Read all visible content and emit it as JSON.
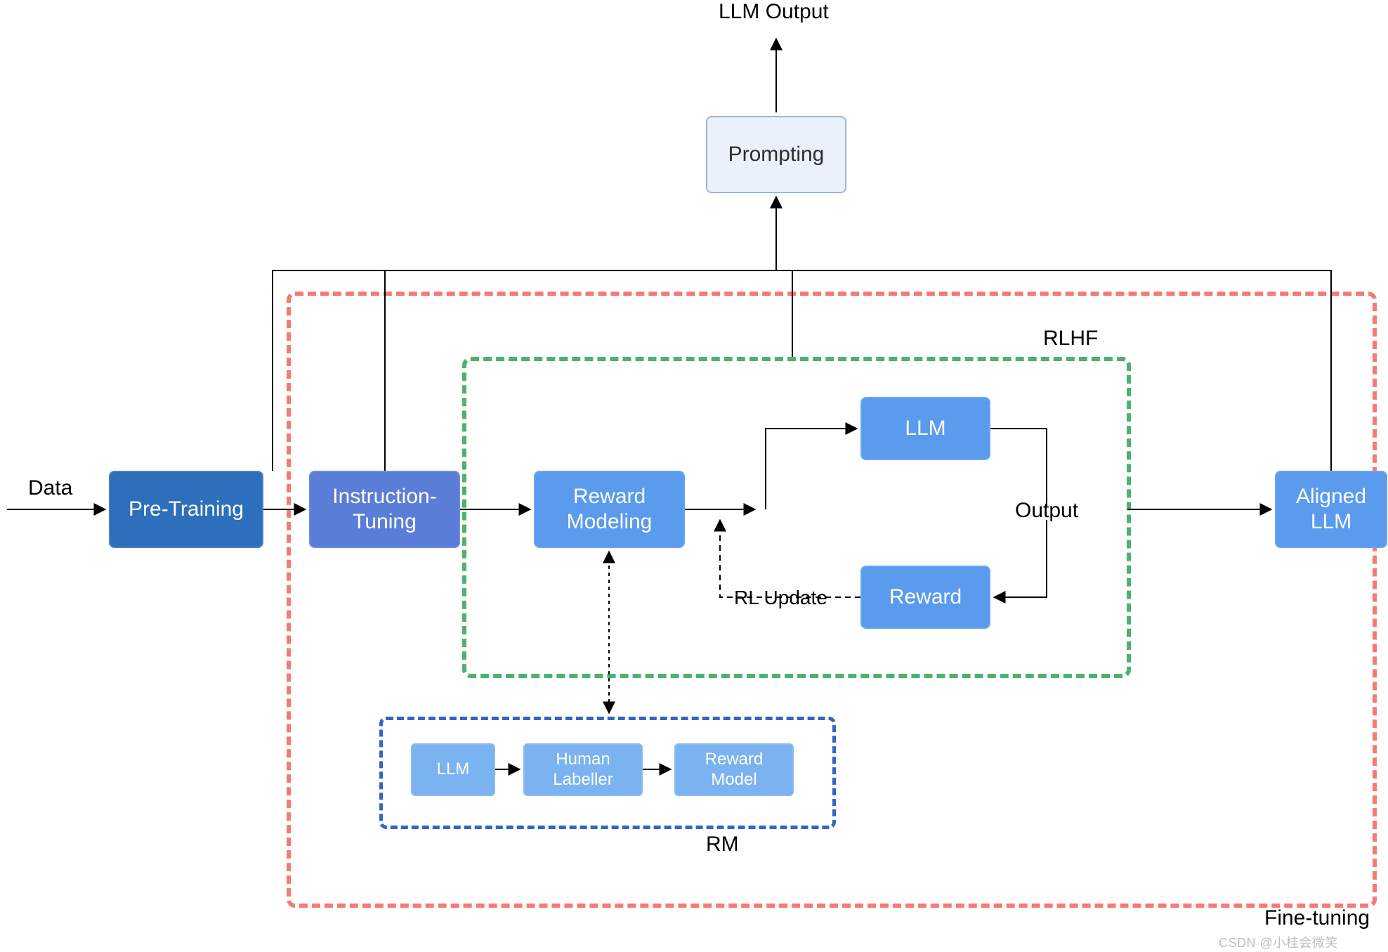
{
  "labels": {
    "data": "Data",
    "llm_output": "LLM Output",
    "output": "Output",
    "rl_update": "RL Update",
    "rlhf": "RLHF",
    "rm": "RM",
    "fine_tuning": "Fine-tuning",
    "watermark": "CSDN @小桂会微笑"
  },
  "nodes": {
    "pretraining": "Pre-Training",
    "instruction_tuning": "Instruction-\nTuning",
    "reward_modeling": "Reward\nModeling",
    "llm": "LLM",
    "reward": "Reward",
    "aligned_llm": "Aligned\nLLM",
    "prompting": "Prompting",
    "rm_llm": "LLM",
    "rm_human_labeller": "Human\nLabeller",
    "rm_reward_model": "Reward\nModel"
  },
  "colors": {
    "frame_red": "#f47a74",
    "frame_green": "#4db36a",
    "frame_rm": "#3266c5",
    "box_dark": "#2e6fbb",
    "box_mid": "#5a7ed8",
    "box_light": "#5b9bed",
    "box_prompt_bg": "#eaf1fb",
    "box_prompt_border": "#9fb6d0"
  }
}
